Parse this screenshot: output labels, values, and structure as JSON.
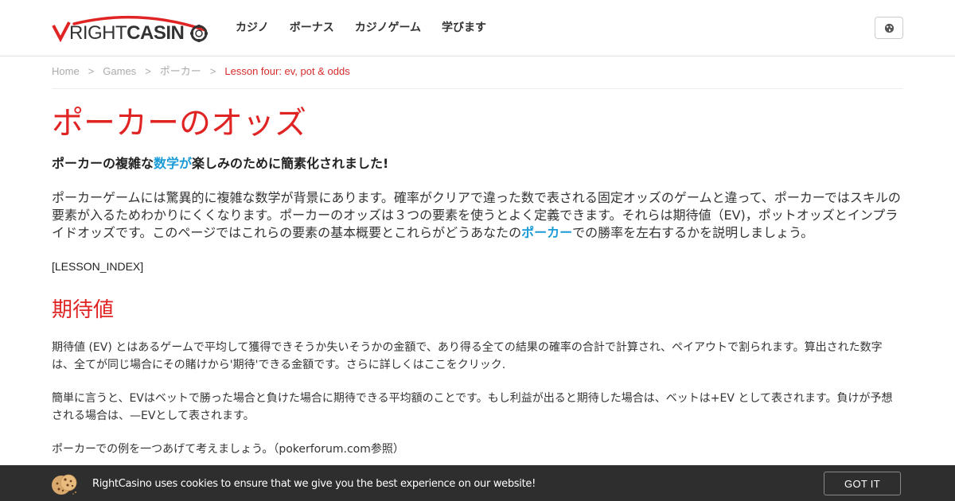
{
  "header": {
    "logo": {
      "word_right": "RIGHT",
      "word_casino": "CASINO",
      "brand_red": "#e02424",
      "brand_dark": "#333333"
    },
    "nav": [
      {
        "label": "カジノ"
      },
      {
        "label": "ボーナス"
      },
      {
        "label": "カジノゲーム"
      },
      {
        "label": "学びます"
      }
    ],
    "language_icon": "globe-icon"
  },
  "breadcrumb": {
    "items": [
      "Home",
      "Games",
      "ポーカー"
    ],
    "separator": ">",
    "current": "Lesson four: ev, pot & odds"
  },
  "article": {
    "title": "ポーカーのオッズ",
    "subtitle": {
      "before": "ポーカーの複雑な",
      "link": "数学が",
      "after": "楽しみのために簡素化されました!"
    },
    "lead": {
      "before": "ポーカーゲームには驚異的に複雑な数学が背景にあります。確率がクリアで違った数で表される固定オッズのゲームと違って、ポーカーではスキルの要素が入るためわかりにくくなります。ポーカーのオッズは３つの要素を使うとよく定義できます。それらは期待値（EV)，ポットオッズとインプライドオッズです。このページではこれらの要素の基本概要とこれらがどうあなたの",
      "link": "ポーカー",
      "after": "での勝率を左右するかを説明しましょう。"
    },
    "lesson_index": "[LESSON_INDEX]",
    "section_title": "期待値",
    "paragraphs": [
      "期待値 (EV) とはあるゲームで平均して獲得できそうか失いそうかの金額で、あり得る全ての結果の確率の合計で計算され、ペイアウトで割られます。算出された数字は、全てが同じ場合にその賭けから'期待'できる金額です。さらに詳しくはここをクリック.",
      "簡単に言うと、EVはベットで勝った場合と負けた場合に期待できる平均額のことです。もし利益が出ると期待した場合は、ベットは+EV として表されます。負けが予想される場合は、—EVとして表されます。",
      "ポーカーでの例を一つあげて考えましょう。（pokerforum.com参照）"
    ],
    "title_color": "#e02424",
    "link_color": "#1a9bd7"
  },
  "cookie_bar": {
    "icon": "cookie-icon",
    "message": "RightCasino uses cookies to ensure that we give you the best experience on our website!",
    "button_label": "GOT IT",
    "background": "#2e2e2e"
  }
}
